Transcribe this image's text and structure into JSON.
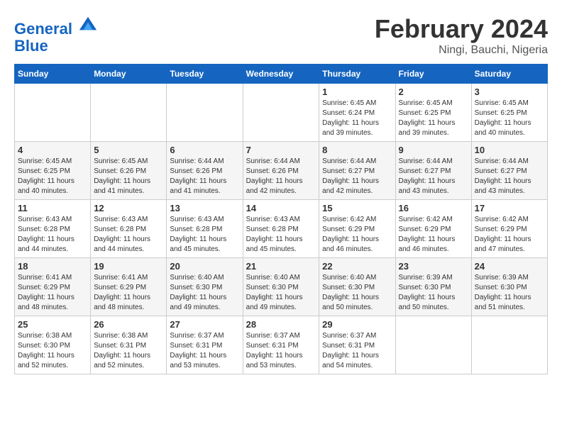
{
  "header": {
    "logo_line1": "General",
    "logo_line2": "Blue",
    "title": "February 2024",
    "subtitle": "Ningi, Bauchi, Nigeria"
  },
  "days_of_week": [
    "Sunday",
    "Monday",
    "Tuesday",
    "Wednesday",
    "Thursday",
    "Friday",
    "Saturday"
  ],
  "weeks": [
    [
      {
        "day": "",
        "info": ""
      },
      {
        "day": "",
        "info": ""
      },
      {
        "day": "",
        "info": ""
      },
      {
        "day": "",
        "info": ""
      },
      {
        "day": "1",
        "info": "Sunrise: 6:45 AM\nSunset: 6:24 PM\nDaylight: 11 hours\nand 39 minutes."
      },
      {
        "day": "2",
        "info": "Sunrise: 6:45 AM\nSunset: 6:25 PM\nDaylight: 11 hours\nand 39 minutes."
      },
      {
        "day": "3",
        "info": "Sunrise: 6:45 AM\nSunset: 6:25 PM\nDaylight: 11 hours\nand 40 minutes."
      }
    ],
    [
      {
        "day": "4",
        "info": "Sunrise: 6:45 AM\nSunset: 6:25 PM\nDaylight: 11 hours\nand 40 minutes."
      },
      {
        "day": "5",
        "info": "Sunrise: 6:45 AM\nSunset: 6:26 PM\nDaylight: 11 hours\nand 41 minutes."
      },
      {
        "day": "6",
        "info": "Sunrise: 6:44 AM\nSunset: 6:26 PM\nDaylight: 11 hours\nand 41 minutes."
      },
      {
        "day": "7",
        "info": "Sunrise: 6:44 AM\nSunset: 6:26 PM\nDaylight: 11 hours\nand 42 minutes."
      },
      {
        "day": "8",
        "info": "Sunrise: 6:44 AM\nSunset: 6:27 PM\nDaylight: 11 hours\nand 42 minutes."
      },
      {
        "day": "9",
        "info": "Sunrise: 6:44 AM\nSunset: 6:27 PM\nDaylight: 11 hours\nand 43 minutes."
      },
      {
        "day": "10",
        "info": "Sunrise: 6:44 AM\nSunset: 6:27 PM\nDaylight: 11 hours\nand 43 minutes."
      }
    ],
    [
      {
        "day": "11",
        "info": "Sunrise: 6:43 AM\nSunset: 6:28 PM\nDaylight: 11 hours\nand 44 minutes."
      },
      {
        "day": "12",
        "info": "Sunrise: 6:43 AM\nSunset: 6:28 PM\nDaylight: 11 hours\nand 44 minutes."
      },
      {
        "day": "13",
        "info": "Sunrise: 6:43 AM\nSunset: 6:28 PM\nDaylight: 11 hours\nand 45 minutes."
      },
      {
        "day": "14",
        "info": "Sunrise: 6:43 AM\nSunset: 6:28 PM\nDaylight: 11 hours\nand 45 minutes."
      },
      {
        "day": "15",
        "info": "Sunrise: 6:42 AM\nSunset: 6:29 PM\nDaylight: 11 hours\nand 46 minutes."
      },
      {
        "day": "16",
        "info": "Sunrise: 6:42 AM\nSunset: 6:29 PM\nDaylight: 11 hours\nand 46 minutes."
      },
      {
        "day": "17",
        "info": "Sunrise: 6:42 AM\nSunset: 6:29 PM\nDaylight: 11 hours\nand 47 minutes."
      }
    ],
    [
      {
        "day": "18",
        "info": "Sunrise: 6:41 AM\nSunset: 6:29 PM\nDaylight: 11 hours\nand 48 minutes."
      },
      {
        "day": "19",
        "info": "Sunrise: 6:41 AM\nSunset: 6:29 PM\nDaylight: 11 hours\nand 48 minutes."
      },
      {
        "day": "20",
        "info": "Sunrise: 6:40 AM\nSunset: 6:30 PM\nDaylight: 11 hours\nand 49 minutes."
      },
      {
        "day": "21",
        "info": "Sunrise: 6:40 AM\nSunset: 6:30 PM\nDaylight: 11 hours\nand 49 minutes."
      },
      {
        "day": "22",
        "info": "Sunrise: 6:40 AM\nSunset: 6:30 PM\nDaylight: 11 hours\nand 50 minutes."
      },
      {
        "day": "23",
        "info": "Sunrise: 6:39 AM\nSunset: 6:30 PM\nDaylight: 11 hours\nand 50 minutes."
      },
      {
        "day": "24",
        "info": "Sunrise: 6:39 AM\nSunset: 6:30 PM\nDaylight: 11 hours\nand 51 minutes."
      }
    ],
    [
      {
        "day": "25",
        "info": "Sunrise: 6:38 AM\nSunset: 6:30 PM\nDaylight: 11 hours\nand 52 minutes."
      },
      {
        "day": "26",
        "info": "Sunrise: 6:38 AM\nSunset: 6:31 PM\nDaylight: 11 hours\nand 52 minutes."
      },
      {
        "day": "27",
        "info": "Sunrise: 6:37 AM\nSunset: 6:31 PM\nDaylight: 11 hours\nand 53 minutes."
      },
      {
        "day": "28",
        "info": "Sunrise: 6:37 AM\nSunset: 6:31 PM\nDaylight: 11 hours\nand 53 minutes."
      },
      {
        "day": "29",
        "info": "Sunrise: 6:37 AM\nSunset: 6:31 PM\nDaylight: 11 hours\nand 54 minutes."
      },
      {
        "day": "",
        "info": ""
      },
      {
        "day": "",
        "info": ""
      }
    ]
  ]
}
